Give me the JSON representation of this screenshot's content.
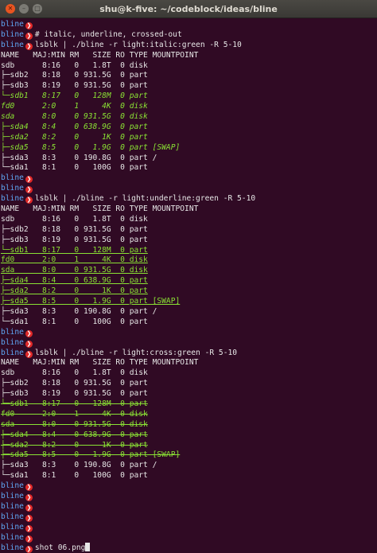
{
  "window": {
    "title": "shu@k-five: ~/codeblock/ideas/bline",
    "close_glyph": "✕",
    "min_glyph": "–",
    "max_glyph": "□"
  },
  "prompt": {
    "name": "bline",
    "arrow_glyph": "❯"
  },
  "colors": {
    "background": "#300a24",
    "text": "#e6e6e6",
    "prompt_name": "#5fa8f5",
    "prompt_arrow": "#e02a2a",
    "highlight": "#8ae234"
  },
  "lines": [
    {
      "prompt": true,
      "text": ""
    },
    {
      "prompt": true,
      "text": "# italic, underline, crossed-out"
    },
    {
      "prompt": true,
      "text": "lsblk | ./bline -r light:italic:green -R 5-10"
    },
    {
      "prompt": false,
      "text": "NAME   MAJ:MIN RM   SIZE RO TYPE MOUNTPOINT"
    },
    {
      "prompt": false,
      "text": "sdb      8:16   0   1.8T  0 disk"
    },
    {
      "prompt": false,
      "text": "├─sdb2   8:18   0 931.5G  0 part"
    },
    {
      "prompt": false,
      "text": "├─sdb3   8:19   0 931.5G  0 part"
    },
    {
      "prompt": false,
      "text": "└─sdb1   8:17   0   128M  0 part",
      "hl": "italic"
    },
    {
      "prompt": false,
      "text": "fd0      2:0    1     4K  0 disk",
      "hl": "italic"
    },
    {
      "prompt": false,
      "text": "sda      8:0    0 931.5G  0 disk",
      "hl": "italic"
    },
    {
      "prompt": false,
      "text": "├─sda4   8:4    0 638.9G  0 part",
      "hl": "italic"
    },
    {
      "prompt": false,
      "text": "├─sda2   8:2    0     1K  0 part",
      "hl": "italic"
    },
    {
      "prompt": false,
      "text": "├─sda5   8:5    0   1.9G  0 part [SWAP]",
      "hl": "italic"
    },
    {
      "prompt": false,
      "text": "├─sda3   8:3    0 190.8G  0 part /"
    },
    {
      "prompt": false,
      "text": "└─sda1   8:1    0   100G  0 part"
    },
    {
      "prompt": true,
      "text": ""
    },
    {
      "prompt": true,
      "text": ""
    },
    {
      "prompt": true,
      "text": "lsblk | ./bline -r light:underline:green -R 5-10"
    },
    {
      "prompt": false,
      "text": "NAME   MAJ:MIN RM   SIZE RO TYPE MOUNTPOINT"
    },
    {
      "prompt": false,
      "text": "sdb      8:16   0   1.8T  0 disk"
    },
    {
      "prompt": false,
      "text": "├─sdb2   8:18   0 931.5G  0 part"
    },
    {
      "prompt": false,
      "text": "├─sdb3   8:19   0 931.5G  0 part"
    },
    {
      "prompt": false,
      "text": "└─sdb1   8:17   0   128M  0 part",
      "hl": "underline"
    },
    {
      "prompt": false,
      "text": "fd0      2:0    1     4K  0 disk",
      "hl": "underline"
    },
    {
      "prompt": false,
      "text": "sda      8:0    0 931.5G  0 disk",
      "hl": "underline"
    },
    {
      "prompt": false,
      "text": "├─sda4   8:4    0 638.9G  0 part",
      "hl": "underline"
    },
    {
      "prompt": false,
      "text": "├─sda2   8:2    0     1K  0 part",
      "hl": "underline"
    },
    {
      "prompt": false,
      "text": "├─sda5   8:5    0   1.9G  0 part [SWAP]",
      "hl": "underline"
    },
    {
      "prompt": false,
      "text": "├─sda3   8:3    0 190.8G  0 part /"
    },
    {
      "prompt": false,
      "text": "└─sda1   8:1    0   100G  0 part"
    },
    {
      "prompt": true,
      "text": ""
    },
    {
      "prompt": true,
      "text": ""
    },
    {
      "prompt": true,
      "text": "lsblk | ./bline -r light:cross:green -R 5-10"
    },
    {
      "prompt": false,
      "text": "NAME   MAJ:MIN RM   SIZE RO TYPE MOUNTPOINT"
    },
    {
      "prompt": false,
      "text": "sdb      8:16   0   1.8T  0 disk"
    },
    {
      "prompt": false,
      "text": "├─sdb2   8:18   0 931.5G  0 part"
    },
    {
      "prompt": false,
      "text": "├─sdb3   8:19   0 931.5G  0 part"
    },
    {
      "prompt": false,
      "text": "└─sdb1   8:17   0   128M  0 part",
      "hl": "cross"
    },
    {
      "prompt": false,
      "text": "fd0      2:0    1     4K  0 disk",
      "hl": "cross"
    },
    {
      "prompt": false,
      "text": "sda      8:0    0 931.5G  0 disk",
      "hl": "cross"
    },
    {
      "prompt": false,
      "text": "├─sda4   8:4    0 638.9G  0 part",
      "hl": "cross"
    },
    {
      "prompt": false,
      "text": "├─sda2   8:2    0     1K  0 part",
      "hl": "cross"
    },
    {
      "prompt": false,
      "text": "├─sda5   8:5    0   1.9G  0 part [SWAP]",
      "hl": "cross"
    },
    {
      "prompt": false,
      "text": "├─sda3   8:3    0 190.8G  0 part /"
    },
    {
      "prompt": false,
      "text": "└─sda1   8:1    0   100G  0 part"
    },
    {
      "prompt": true,
      "text": ""
    },
    {
      "prompt": true,
      "text": ""
    },
    {
      "prompt": true,
      "text": ""
    },
    {
      "prompt": true,
      "text": ""
    },
    {
      "prompt": true,
      "text": ""
    },
    {
      "prompt": true,
      "text": ""
    },
    {
      "prompt": true,
      "text": "shot 06.png",
      "cursor": true
    }
  ]
}
